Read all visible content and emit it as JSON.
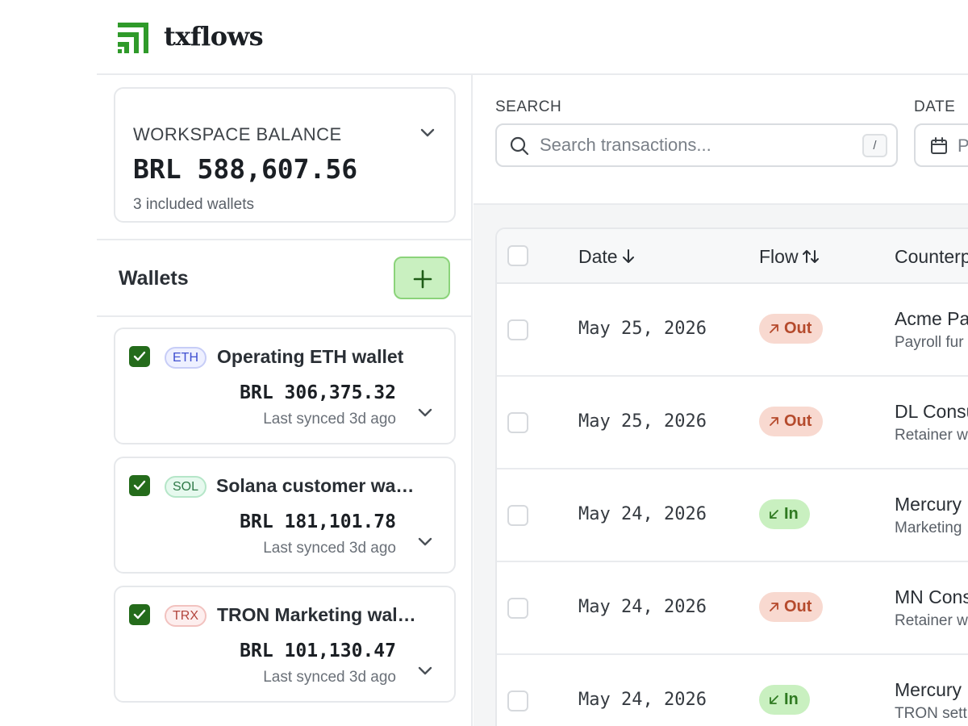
{
  "app": {
    "name": "txflows"
  },
  "balance": {
    "label": "WORKSPACE BALANCE",
    "value": "BRL 588,607.56",
    "subtitle": "3 included wallets"
  },
  "wallets": {
    "title": "Wallets",
    "items": [
      {
        "chain": "ETH",
        "name": "Operating ETH wallet",
        "amount": "BRL 306,375.32",
        "sync": "Last synced 3d ago",
        "checked": true
      },
      {
        "chain": "SOL",
        "name": "Solana customer wa…",
        "amount": "BRL 181,101.78",
        "sync": "Last synced 3d ago",
        "checked": true
      },
      {
        "chain": "TRX",
        "name": "TRON Marketing wal…",
        "amount": "BRL 101,130.47",
        "sync": "Last synced 3d ago",
        "checked": true
      }
    ]
  },
  "search": {
    "label": "SEARCH",
    "placeholder": "Search transactions...",
    "shortcut": "/"
  },
  "date_filter": {
    "label": "DATE",
    "value": "P"
  },
  "table": {
    "columns": [
      "Date",
      "Flow",
      "Counterp"
    ],
    "rows": [
      {
        "date": "May 25, 2026",
        "flow": "Out",
        "counterparty": "Acme Pa",
        "note": "Payroll fur"
      },
      {
        "date": "May 25, 2026",
        "flow": "Out",
        "counterparty": "DL Consu",
        "note": "Retainer w"
      },
      {
        "date": "May 24, 2026",
        "flow": "In",
        "counterparty": "Mercury",
        "note": "Marketing"
      },
      {
        "date": "May 24, 2026",
        "flow": "Out",
        "counterparty": "MN Cons",
        "note": "Retainer w"
      },
      {
        "date": "May 24, 2026",
        "flow": "In",
        "counterparty": "Mercury",
        "note": "TRON sett"
      }
    ]
  },
  "colors": {
    "brand": "#2f9a2a",
    "checkbox": "#246b1b",
    "flow_out_bg": "#f8d9d0",
    "flow_out_text": "#b54a2c",
    "flow_in_bg": "#c9f0c0",
    "flow_in_text": "#2f7a21"
  }
}
